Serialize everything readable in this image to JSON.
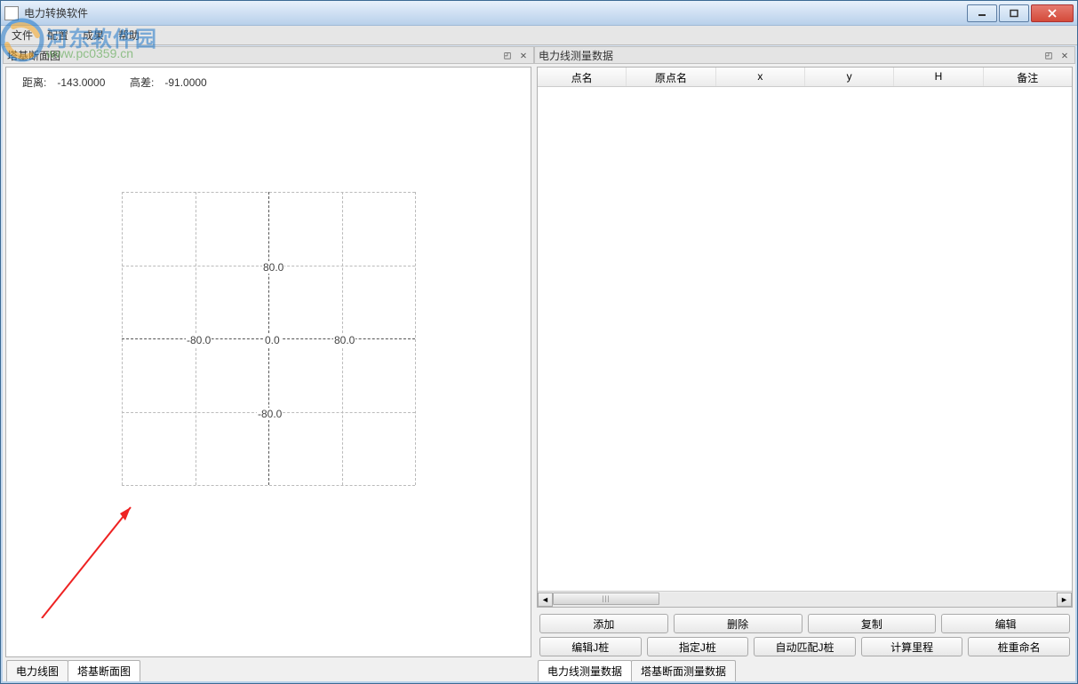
{
  "window": {
    "title": "电力转换软件"
  },
  "menubar": {
    "items": [
      "文件",
      "配置",
      "成果",
      "帮助"
    ]
  },
  "left_pane": {
    "title": "塔基断面图",
    "info_distance_label": "距离:",
    "info_distance_value": "-143.0000",
    "info_height_label": "高差:",
    "info_height_value": "-91.0000",
    "tabs": [
      "电力线图",
      "塔基断面图"
    ],
    "active_tab": 1
  },
  "right_pane": {
    "title": "电力线测量数据",
    "columns": [
      "点名",
      "原点名",
      "x",
      "y",
      "H",
      "备注"
    ],
    "buttons_row1": [
      "添加",
      "删除",
      "复制",
      "编辑"
    ],
    "buttons_row2": [
      "编辑J桩",
      "指定J桩",
      "自动匹配J桩",
      "计算里程",
      "桩重命名"
    ],
    "tabs": [
      "电力线测量数据",
      "塔基断面测量数据"
    ],
    "active_tab": 0
  },
  "watermark": {
    "text1": "河东软件园",
    "text2": "www.pc0359.cn"
  },
  "chart_data": {
    "type": "scatter",
    "title": "",
    "xlabel": "",
    "ylabel": "",
    "xlim": [
      -160,
      160
    ],
    "ylim": [
      -160,
      160
    ],
    "x_ticks": [
      -80.0,
      0.0,
      80.0
    ],
    "y_ticks": [
      -80.0,
      80.0
    ],
    "x_tick_labels": [
      "-80.0",
      "0.0",
      "80.0"
    ],
    "y_tick_labels": [
      "-80.0",
      "80.0"
    ],
    "series": []
  }
}
